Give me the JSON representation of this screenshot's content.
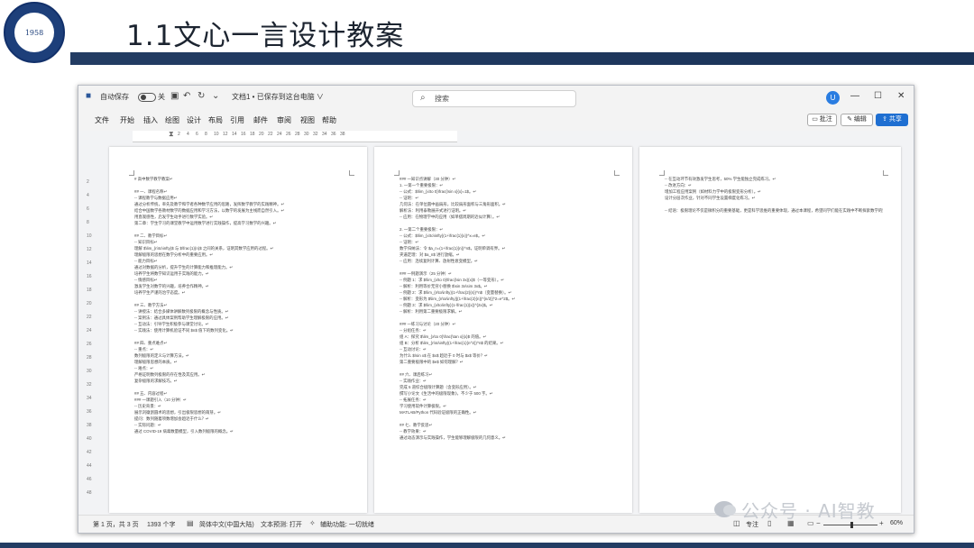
{
  "slide": {
    "title": "1.1文心一言设计教案",
    "logo_year": "1958"
  },
  "titlebar": {
    "autosave_label": "自动保存",
    "autosave_state": "关",
    "doc_title": "文档1 • 已保存到这台电脑 ∨",
    "search_placeholder": "搜索",
    "user_initial": "U"
  },
  "menu": {
    "items": [
      "文件",
      "开始",
      "插入",
      "绘图",
      "设计",
      "布局",
      "引用",
      "邮件",
      "审阅",
      "视图",
      "帮助"
    ],
    "comment_label": "批注",
    "edit_label": "编辑",
    "share_label": "共享"
  },
  "ruler": {
    "numbers": [
      "2",
      "4",
      "6",
      "8",
      "10",
      "12",
      "14",
      "16",
      "18",
      "20",
      "22",
      "24",
      "26",
      "28",
      "30",
      "32",
      "34",
      "36",
      "38"
    ]
  },
  "vruler": {
    "numbers": [
      "2",
      "4",
      "6",
      "8",
      "10",
      "12",
      "14",
      "16",
      "18",
      "20",
      "22",
      "24",
      "26",
      "28",
      "30",
      "32",
      "34",
      "36",
      "38",
      "40",
      "42",
      "44",
      "46",
      "48"
    ]
  },
  "pages": [
    {
      "lines": [
        "# 高中数学教学教案↵",
        "",
        "## 一、课程名称↵",
        "-- 课程教学与数据应用↵",
        "  通过分析传统，率先及教学和学者各种数学应用的思路，发挥数学教学的实践精神。↵",
        "  结合中国数学各教材数学的数据应用和学习方法，以数学的发展为主线而自然引入。↵",
        "  用直观感性，启发学生动手进行数学实验。↵",
        "  第二章：学生学习的课堂教学中运用数学进行实践操作，提高学习数学的兴趣。↵",
        "",
        "## 二、教学目标↵",
        "-- 知识目标↵",
        "  理解 $\\lim_{n\\to\\infty}$ 与 $\\frac{1}{n}$ 之间的关系，证明其数学应用的过程。↵",
        "  理解极限的思想在数学分析中的重要应用。↵",
        "-- 能力目标↵",
        "  通过对数据的分析，提升学生的计算能力和推理能力。↵",
        "  培养学生将数学知识运用于实践的能力。↵",
        "-- 情感目标↵",
        "  激发学生对数学的兴趣，培养合作精神。↵",
        "  培养学生严谨的治学态度。↵",
        "",
        "## 三、教学方法↵",
        "-- 讲授法：结合多媒体讲解数列极限的概念与性质。↵",
        "-- 案例法：通过具体案例帮助学生理解极限的应用。↵",
        "-- 互动法：引导学生积极参与课堂讨论。↵",
        "-- 实践法：使用计算机验证不同 $n$ 值下的数列变化。↵",
        "",
        "## 四、重点难点↵",
        "-- 重点：↵",
        "  数列极限的定义与计算方法。↵",
        "  理解极限思想的本质。↵",
        "-- 难点：↵",
        "  严格证明数列极限的存在性及其应用。↵",
        "  复杂极限的求解技巧。↵",
        "",
        "## 五、内容过程↵",
        "### 一课题引入（10 分钟）↵",
        "-- 历史背景：↵",
        "  展示刘徽割圆术的思想，引出极限思想的萌芽。↵",
        "  提问：数列随着项数增加会趋近于什么？↵",
        "-- 实际问题：↵",
        "  通过 COVID-19 病毒数量模型，引入数列极限的概念。↵"
      ]
    },
    {
      "lines": [
        "### 一知识点讲解（30 分钟）↵",
        "1. 一第一个重要极限：↵",
        "  -- 公式：$\\lim_{x\\to 0}\\frac{\\sin x}{x}=1$。↵",
        "  -- 证明：↵",
        "    几何法：在单位圆中画扇形，比较扇形面积与三角形面积。↵",
        "    解析法：利用泰勒展开式进行证明。↵",
        "  -- 应用：在物理学中的应用（如单摆周期的近似计算）。↵",
        "",
        "2. 一第二个重要极限：↵",
        "  -- 公式：$\\lim_{x\\to\\infty}(1+\\frac{1}{x})^x=e$。↵",
        "  -- 证明：↵",
        "    数学归纳法：令 $a_n=(1+\\frac{1}{n})^n$，证明单调有界。↵",
        "    夹逼定理：对 $a_n$ 进行放缩。↵",
        "  -- 应用：连续复利计算、放射性衰变模型。↵",
        "",
        "### 一例题演示（25 分钟）↵",
        "-- 例题 1：求 $\\lim_{x\\to 0}\\frac{\\sin 3x}{x}$（一等变形）。↵",
        "  -- 解析：利用等价无穷小替换 $\\sin 3x\\sim 3x$。↵",
        "-- 例题 2：求 $\\lim_{n\\to\\infty}(1+\\frac{2}{n})^n$（变量替换）。↵",
        "  -- 解析：变形为 $\\lim_{n\\to\\infty}[(1+\\frac{2}{n})^{n/2}]^2=e^2$。↵",
        "-- 例题 3：求 $\\lim_{x\\to\\infty}(1-\\frac{1}{x})^{2x}$。↵",
        "  -- 解析：利用第二重要极限求解。↵",
        "",
        "### 一练习与讨论（20 分钟）↵",
        "-- 分组任务：↵",
        "  组 A：探究 $\\lim_{x\\to 0}\\frac{\\tan x}{x}$ 的值。↵",
        "  组 B：分析 $\\lim_{n\\to\\infty}(1+\\frac{1}{n^2})^n$ 的结果。↵",
        "-- 互动讨论：↵",
        "  为什么 $\\sin x$ 在 $x$ 趋近于 0 时与 $x$ 等价？↵",
        "  第二重要极限中的 $e$ 如何理解？↵",
        "",
        "## 六、课后练习↵",
        "-- 实践作业：↵",
        "  完成 5 道综合极限计算题（含变形应用）。↵",
        "  撰写小论文《生活中的极限现象》，不少于 500 字。↵",
        "-- 拓展任务：↵",
        "  学习使用软件计算极限。↵",
        "  MATLAB/Python 代码验证极限的正确性。↵",
        "",
        "## 七、教学反思↵",
        "-- 教学效果：↵",
        "  通过动态演示与实践操作，学生能够理解极限的几何意义。↵"
      ]
    },
    {
      "lines": [
        "  -- 在互动环节有效激发学生思考，50% 学生能独立完成练习。↵",
        "  -- 改进方向：↵",
        "    增加工程应用案例（如材料力学中的极限变形分析）。↵",
        "    设计分层次作业，针对不同学生设置梯度化练习。↵",
        "",
        "-- 结语：极限理论不仅是微积分的重要基础，更是科学思维的重要体现，通过本课程，希望同学们能在实践中不断探索数学的魅力。↵"
      ]
    }
  ],
  "statusbar": {
    "page_info": "第 1 页，共 3 页",
    "word_count": "1393 个字",
    "language": "简体中文(中国大陆)",
    "text_prediction": "文本预测: 打开",
    "accessibility": "辅助功能: 一切就绪",
    "focus_label": "专注",
    "zoom_level": "60%"
  },
  "watermark": {
    "text": "公众号 · AI智教"
  },
  "colors": {
    "title_bar": "#233c63",
    "share_button": "#1f6fd1",
    "avatar": "#2a7de1"
  }
}
